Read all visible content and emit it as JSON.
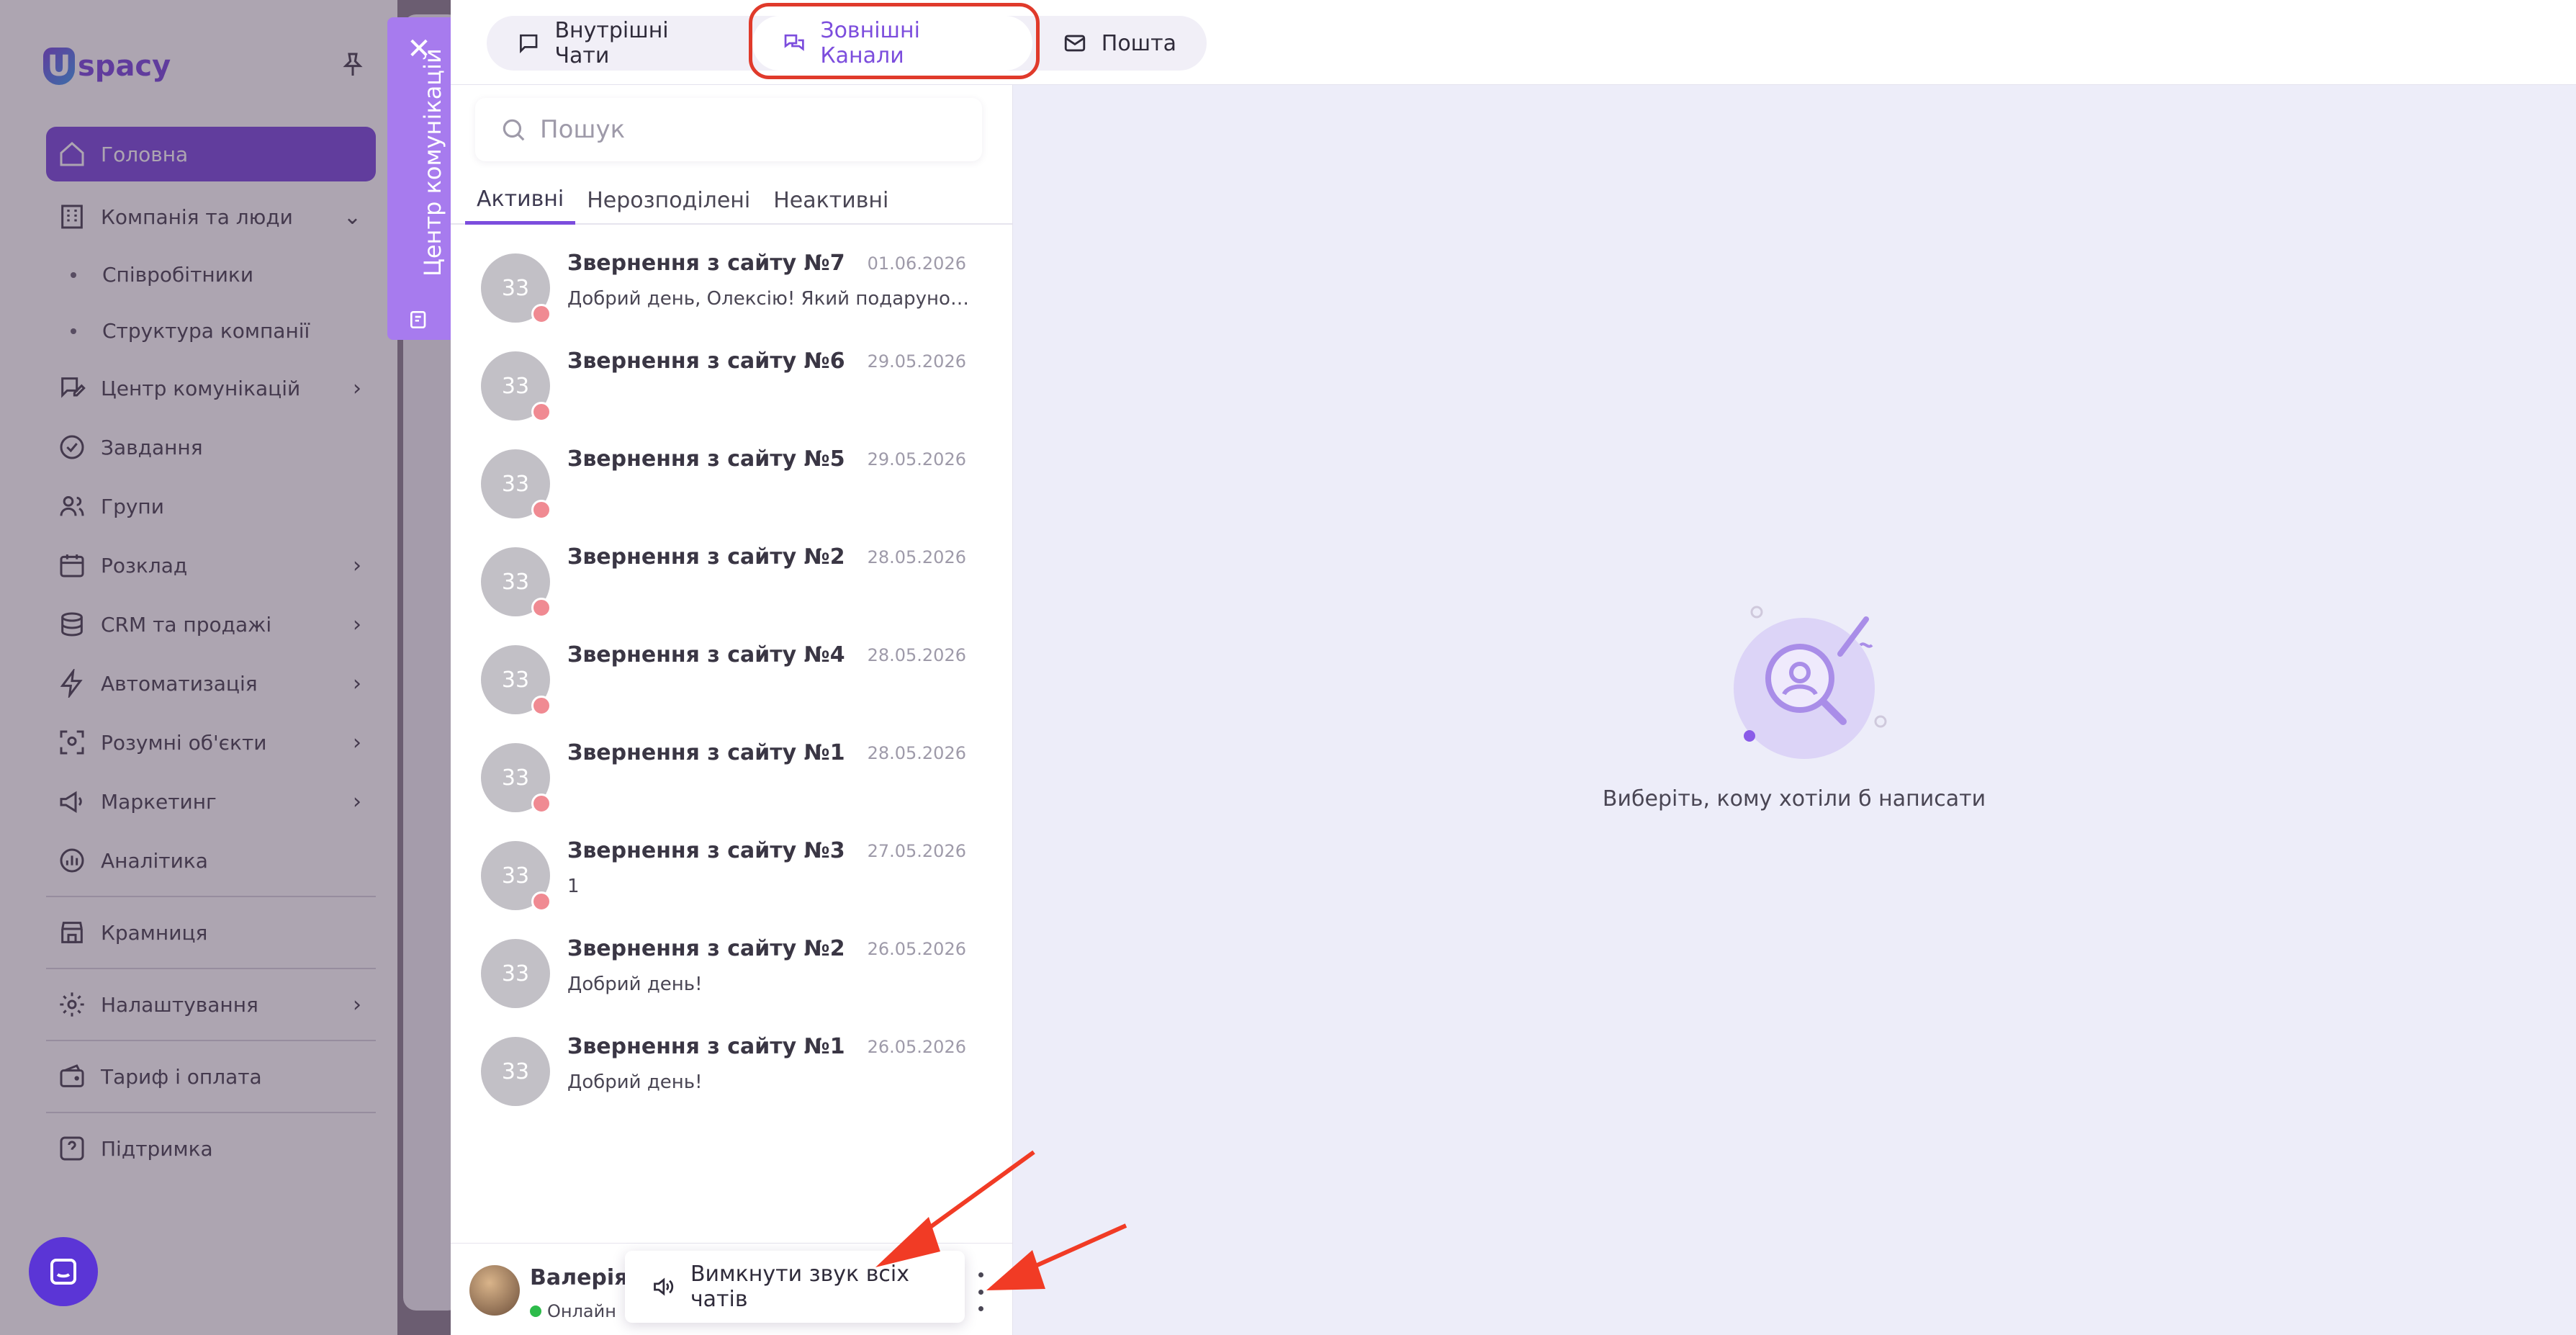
{
  "app": {
    "logo_text": "spacy",
    "brand_color": "#7c4ddd"
  },
  "sidebar": {
    "items": [
      {
        "label": "Головна",
        "icon": "home-icon",
        "active": true
      },
      {
        "label": "Компанія та люди",
        "icon": "building-icon",
        "expanded": true
      },
      {
        "label": "Співробітники",
        "sub": true
      },
      {
        "label": "Структура компанії",
        "sub": true
      },
      {
        "label": "Центр комунікацій",
        "icon": "chat-edit-icon",
        "chevron": true
      },
      {
        "label": "Завдання",
        "icon": "check-circle-icon"
      },
      {
        "label": "Групи",
        "icon": "users-icon"
      },
      {
        "label": "Розклад",
        "icon": "calendar-icon",
        "chevron": true
      },
      {
        "label": "CRM та продажі",
        "icon": "database-icon",
        "chevron": true
      },
      {
        "label": "Автоматизація",
        "icon": "lightning-icon",
        "chevron": true
      },
      {
        "label": "Розумні об'єкти",
        "icon": "scan-icon",
        "chevron": true
      },
      {
        "label": "Маркетинг",
        "icon": "megaphone-icon",
        "chevron": true
      },
      {
        "label": "Аналітика",
        "icon": "chart-icon"
      },
      {
        "label": "Крамниця",
        "icon": "store-icon"
      },
      {
        "label": "Налаштування",
        "icon": "gear-icon",
        "chevron": true
      },
      {
        "label": "Тариф і оплата",
        "icon": "wallet-icon"
      },
      {
        "label": "Підтримка",
        "icon": "help-icon"
      }
    ]
  },
  "comm_center": {
    "vertical_label": "Центр комунікацій",
    "tabs": [
      {
        "label": "Внутрішні Чати",
        "icon": "chat-icon"
      },
      {
        "label": "Зовнішні Канали",
        "icon": "channels-icon",
        "active": true
      },
      {
        "label": "Пошта",
        "icon": "mail-icon"
      }
    ],
    "search": {
      "placeholder": "Пошук"
    },
    "subtabs": [
      "Активні",
      "Нерозподілені",
      "Неактивні"
    ],
    "chats": [
      {
        "title": "Звернення з сайту №7",
        "date": "01.06.2026",
        "preview": "Добрий день, Олексію! Який подарунок шу...",
        "initials": "33"
      },
      {
        "title": "Звернення з сайту №6",
        "date": "29.05.2026",
        "preview": "",
        "initials": "33"
      },
      {
        "title": "Звернення з сайту №5",
        "date": "29.05.2026",
        "preview": "",
        "initials": "33"
      },
      {
        "title": "Звернення з сайту №2",
        "date": "28.05.2026",
        "preview": "",
        "initials": "33"
      },
      {
        "title": "Звернення з сайту №4",
        "date": "28.05.2026",
        "preview": "",
        "initials": "33"
      },
      {
        "title": "Звернення з сайту №1",
        "date": "28.05.2026",
        "preview": "",
        "initials": "33"
      },
      {
        "title": "Звернення з сайту №3",
        "date": "27.05.2026",
        "preview": "1",
        "initials": "33"
      },
      {
        "title": "Звернення з сайту №2",
        "date": "26.05.2026",
        "preview": "Добрий день!",
        "initials": "33"
      },
      {
        "title": "Звернення з сайту №1",
        "date": "26.05.2026",
        "preview": "Добрий день!",
        "initials": "33"
      }
    ],
    "user": {
      "name": "Валерія В",
      "status": "Онлайн"
    },
    "mute_menu": {
      "label": "Вимкнути звук всіх чатів"
    },
    "empty_state": "Виберіть, кому хотіли б написати"
  }
}
